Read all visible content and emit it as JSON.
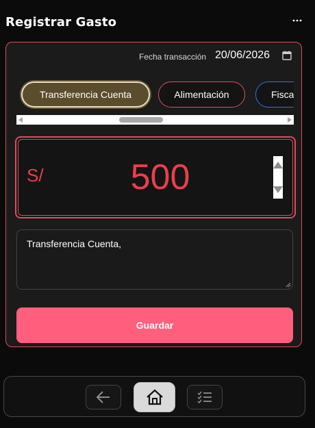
{
  "header": {
    "title": "Registrar Gasto",
    "more_icon": "more-horizontal-icon"
  },
  "form": {
    "date_label": "Fecha transacción",
    "date_value": "20/06/2026",
    "categories": [
      {
        "label": "Transferencia Cuenta",
        "selected": true,
        "border_color": "#e8dfc8",
        "bg_color": "#5b4c2c"
      },
      {
        "label": "Alimentación",
        "selected": false,
        "border_color": "#e04c5c"
      },
      {
        "label": "Fiscal",
        "selected": false,
        "border_color": "#3a6ee8"
      }
    ],
    "currency_symbol": "S/",
    "amount": "500",
    "note": "Transferencia Cuenta,",
    "save_label": "Guardar"
  },
  "nav": {
    "back_icon": "arrow-left-icon",
    "home_icon": "home-icon",
    "list_icon": "checklist-icon",
    "active": "home"
  },
  "colors": {
    "background": "#0b0b0b",
    "card": "#1b1b1b",
    "accent": "#e04c5c",
    "amount": "#e83f4d",
    "button": "#ff5f7c"
  }
}
